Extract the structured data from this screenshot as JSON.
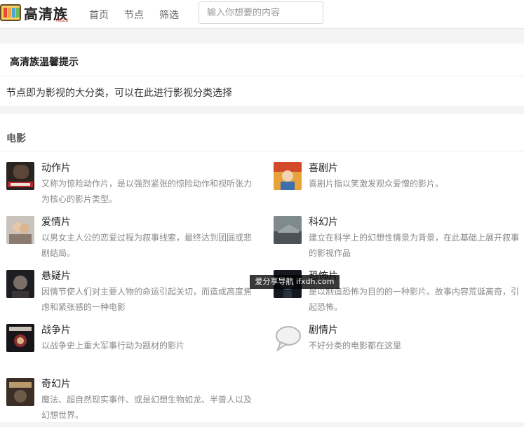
{
  "header": {
    "logo_text": "高清族",
    "logo_sub": "HDZU",
    "nav": [
      "首页",
      "节点",
      "筛选"
    ],
    "search_placeholder": "输入你想要的内容"
  },
  "tip": {
    "title": "高清族温馨提示",
    "text": "节点即为影视的大分类，可以在此进行影视分类选择"
  },
  "section": {
    "title": "电影",
    "items": [
      {
        "name": "动作片",
        "desc": "又称为惊险动作片，是以强烈紧张的惊险动作和视听张力为核心的影片类型。",
        "thumb": "poster-leon"
      },
      {
        "name": "喜剧片",
        "desc": "喜剧片指以笑激发观众爱憎的影片。",
        "thumb": "poster-comedy"
      },
      {
        "name": "爱情片",
        "desc": "以男女主人公的恋爱过程为叙事线索，最终达到团圆或悲剧结局。",
        "thumb": "poster-romance"
      },
      {
        "name": "科幻片",
        "desc": "建立在科学上的幻想性情景为背景，在此基础上展开叙事的影视作品",
        "thumb": "poster-scifi"
      },
      {
        "name": "悬疑片",
        "desc": "因情节使人们对主要人物的命运引起关切，而造成高度焦虑和紧张感的一种电影",
        "thumb": "poster-suspense"
      },
      {
        "name": "恐怖片",
        "desc": "是以制造恐怖为目的的一种影片。故事内容荒诞离奇，引起恐怖。",
        "thumb": "poster-horror"
      },
      {
        "name": "战争片",
        "desc": "以战争史上重大军事行动为题材的影片",
        "thumb": "poster-war"
      },
      {
        "name": "剧情片",
        "desc": "不好分类的电影都在这里",
        "thumb": "speech-bubble-icon"
      },
      {
        "name": "奇幻片",
        "desc": "魔法、超自然现实事件、或是幻想生物如龙、半兽人以及幻想世界。",
        "thumb": "poster-fantasy"
      }
    ]
  },
  "watermark": "爱分享导航 ifxdh.com"
}
